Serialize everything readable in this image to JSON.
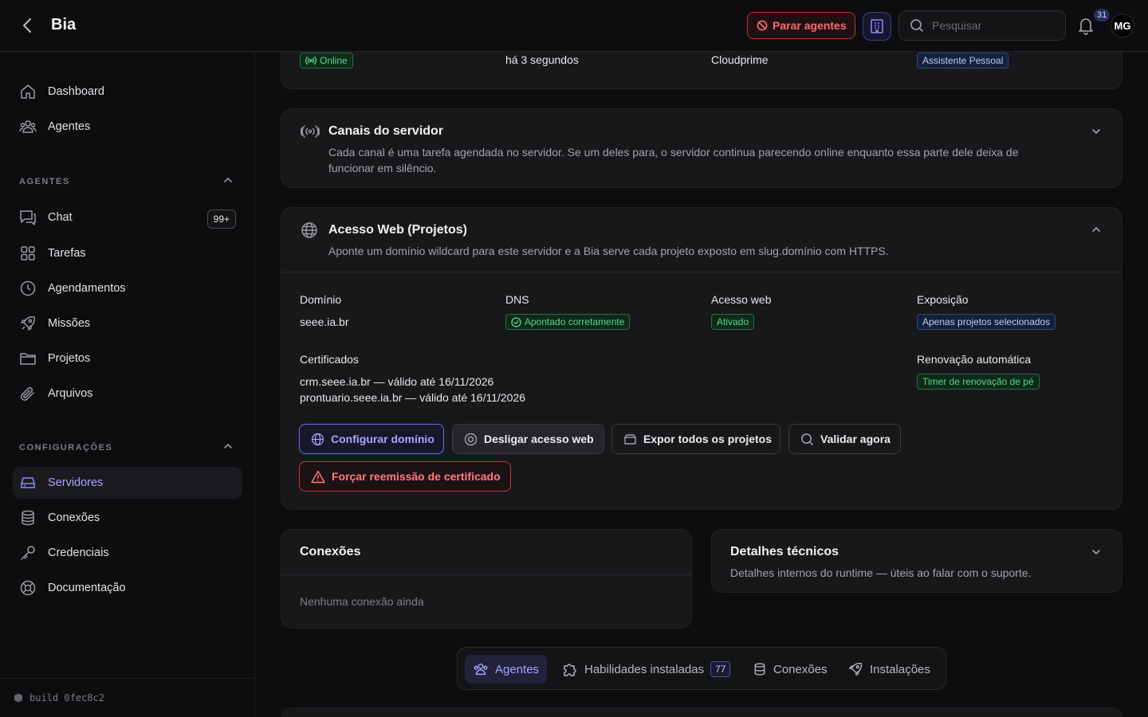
{
  "header": {
    "title": "Bia",
    "stop_agents": "Parar agentes",
    "search_placeholder": "Pesquisar",
    "notifications_count": "31",
    "avatar_initials": "MG"
  },
  "sidebar": {
    "top_items": [
      {
        "label": "Dashboard",
        "icon": "home-icon"
      },
      {
        "label": "Agentes",
        "icon": "users-icon"
      }
    ],
    "agents_section": "AGENTES",
    "agents_items": [
      {
        "label": "Chat",
        "icon": "chat-icon",
        "badge": "99+"
      },
      {
        "label": "Tarefas",
        "icon": "grid-icon"
      },
      {
        "label": "Agendamentos",
        "icon": "clock-icon"
      },
      {
        "label": "Missões",
        "icon": "rocket-icon"
      },
      {
        "label": "Projetos",
        "icon": "folder-icon"
      },
      {
        "label": "Arquivos",
        "icon": "paperclip-icon"
      }
    ],
    "config_section": "CONFIGURAÇÕES",
    "config_items": [
      {
        "label": "Servidores",
        "icon": "server-icon",
        "active": true
      },
      {
        "label": "Conexões",
        "icon": "database-icon"
      },
      {
        "label": "Credenciais",
        "icon": "key-icon"
      },
      {
        "label": "Documentação",
        "icon": "lifebuoy-icon"
      }
    ],
    "build": "build 0fec8c2"
  },
  "server_summary": {
    "status": "Online",
    "last_seen": "há 3 segundos",
    "provider": "Cloudprime",
    "role": "Assistente Pessoal"
  },
  "channels": {
    "title": "Canais do servidor",
    "description": "Cada canal é uma tarefa agendada no servidor. Se um deles para, o servidor continua parecendo online enquanto essa parte dele deixa de funcionar em silêncio."
  },
  "web_access": {
    "title": "Acesso Web (Projetos)",
    "description": "Aponte um domínio wildcard para este servidor e a Bia serve cada projeto exposto em slug.domínio com HTTPS.",
    "domain_label": "Domínio",
    "domain_value": "seee.ia.br",
    "dns_label": "DNS",
    "dns_value": "Apontado corretamente",
    "web_label": "Acesso web",
    "web_value": "Ativado",
    "exposure_label": "Exposição",
    "exposure_value": "Apenas projetos selecionados",
    "certs_label": "Certificados",
    "certs": [
      "crm.seee.ia.br — válido até 16/11/2026",
      "prontuario.seee.ia.br — válido até 16/11/2026"
    ],
    "renew_label": "Renovação automática",
    "renew_value": "Timer de renovação de pé",
    "buttons": {
      "configure": "Configurar domínio",
      "disable": "Desligar acesso web",
      "expose_all": "Expor todos os projetos",
      "validate": "Validar agora",
      "force_reissue": "Forçar reemissão de certificado"
    }
  },
  "connections": {
    "title": "Conexões",
    "empty": "Nenhuma conexão ainda"
  },
  "tech_details": {
    "title": "Detalhes técnicos",
    "description": "Detalhes internos do runtime — úteis ao falar com o suporte."
  },
  "tabs": [
    {
      "label": "Agentes",
      "icon": "users-icon",
      "active": true
    },
    {
      "label": "Habilidades instaladas",
      "icon": "puzzle-icon",
      "count": "77"
    },
    {
      "label": "Conexões",
      "icon": "database-icon"
    },
    {
      "label": "Instalações",
      "icon": "rocket-icon"
    }
  ],
  "colors": {
    "accent": "#8a8cff",
    "danger": "#ff6a6f",
    "success": "#58d68b"
  }
}
